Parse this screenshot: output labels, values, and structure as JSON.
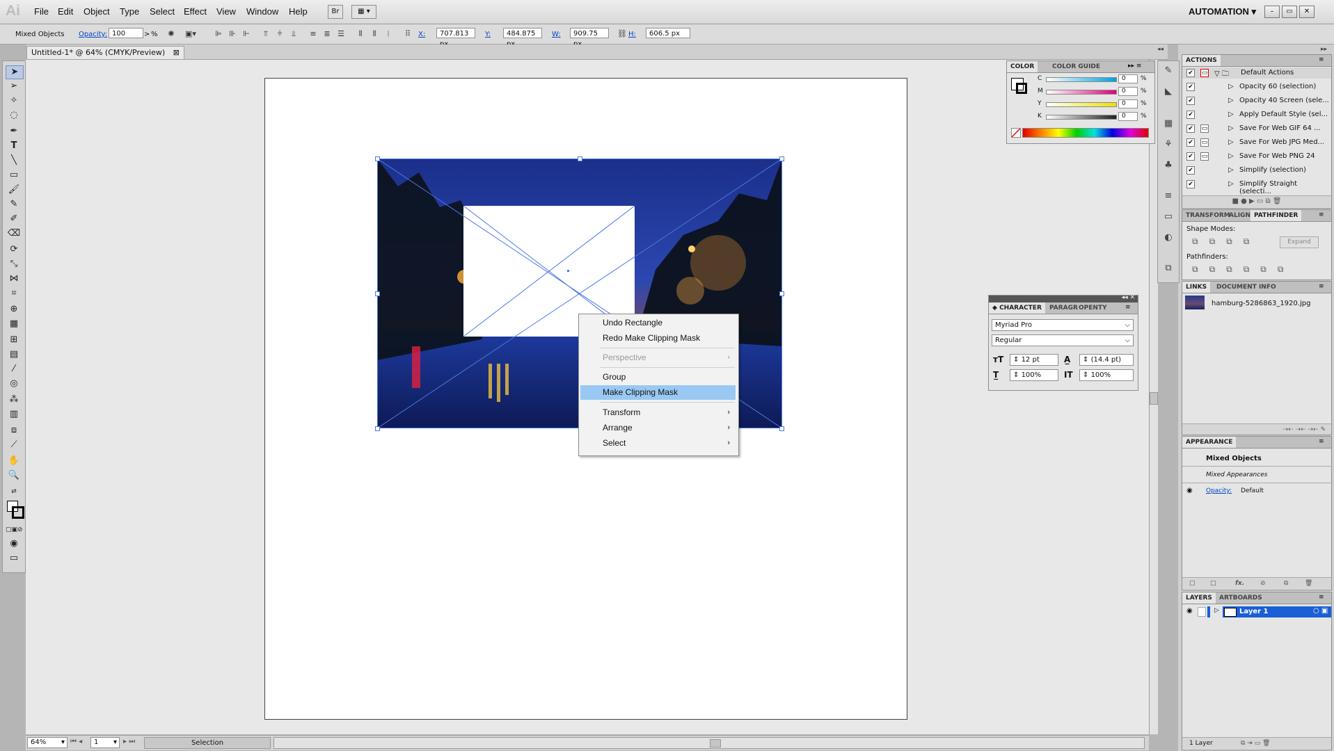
{
  "app": {
    "logo": "Ai"
  },
  "menubar": {
    "items": [
      "File",
      "Edit",
      "Object",
      "Type",
      "Select",
      "Effect",
      "View",
      "Window",
      "Help"
    ],
    "bridge_label": "Br",
    "workspace": "AUTOMATION",
    "window_buttons": [
      "–",
      "▭",
      "✕"
    ]
  },
  "controlbar": {
    "selection_label": "Mixed Objects",
    "opacity_label": "Opacity:",
    "opacity_value": "100",
    "opacity_unit": "%",
    "x_label": "X:",
    "x_value": "707.813 px",
    "y_label": "Y:",
    "y_value": "484.875 px",
    "w_label": "W:",
    "w_value": "909.75 px",
    "h_label": "H:",
    "h_value": "606.5 px"
  },
  "document": {
    "tab_title": "Untitled-1* @ 64% (CMYK/Preview)",
    "tab_close": "⊠"
  },
  "context_menu": {
    "items": [
      {
        "label": "Undo Rectangle",
        "state": "normal",
        "submenu": false
      },
      {
        "label": "Redo Make Clipping Mask",
        "state": "normal",
        "submenu": false
      },
      {
        "label": "Perspective",
        "state": "disabled",
        "submenu": true
      },
      {
        "label": "Group",
        "state": "normal",
        "submenu": false
      },
      {
        "label": "Make Clipping Mask",
        "state": "selected",
        "submenu": false
      },
      {
        "label": "Transform",
        "state": "normal",
        "submenu": true
      },
      {
        "label": "Arrange",
        "state": "normal",
        "submenu": true
      },
      {
        "label": "Select",
        "state": "normal",
        "submenu": true
      }
    ]
  },
  "statusbar": {
    "zoom": "64%",
    "page": "1",
    "tool": "Selection"
  },
  "color_panel": {
    "tabs": [
      "COLOR",
      "COLOR GUIDE"
    ],
    "channels": [
      {
        "label": "C",
        "value": "0",
        "unit": "%",
        "color": "#00a0e0"
      },
      {
        "label": "M",
        "value": "0",
        "unit": "%",
        "color": "#e0007a"
      },
      {
        "label": "Y",
        "value": "0",
        "unit": "%",
        "color": "#f0e000"
      },
      {
        "label": "K",
        "value": "0",
        "unit": "%",
        "color": "#222222"
      }
    ]
  },
  "character_panel": {
    "tabs": [
      "CHARACTER",
      "PARAGR",
      "OPENTY"
    ],
    "font_family": "Myriad Pro",
    "font_style": "Regular",
    "font_size": "12 pt",
    "leading": "(14.4 pt)",
    "vertical_scale": "100%",
    "horizontal_scale": "100%"
  },
  "actions_panel": {
    "tab": "ACTIONS",
    "set_name": "Default Actions",
    "actions": [
      "Opacity 60 (selection)",
      "Opacity 40 Screen (sele...",
      "Apply Default Style (sel...",
      "Save For Web GIF 64 ...",
      "Save For Web JPG Med...",
      "Save For Web PNG 24",
      "Simplify (selection)",
      "Simplify Straight (selecti..."
    ]
  },
  "pathfinder_panel": {
    "tabs": [
      "TRANSFORM",
      "ALIGN",
      "PATHFINDER"
    ],
    "shape_modes_label": "Shape Modes:",
    "pathfinders_label": "Pathfinders:",
    "expand_label": "Expand"
  },
  "links_panel": {
    "tabs": [
      "LINKS",
      "DOCUMENT INFO"
    ],
    "file": "hamburg-5286863_1920.jpg"
  },
  "appearance_panel": {
    "tab": "APPEARANCE",
    "title": "Mixed Objects",
    "subtitle": "Mixed Appearances",
    "opacity_label": "Opacity:",
    "opacity_value": "Default",
    "fx_label": "fx."
  },
  "layers_panel": {
    "tabs": [
      "LAYERS",
      "ARTBOARDS"
    ],
    "layer_name": "Layer 1",
    "footer": "1 Layer"
  },
  "colors": {
    "selection_blue": "#4a78e0",
    "menu_highlight": "#99c9f3",
    "layer_highlight": "#1a5fd6"
  }
}
